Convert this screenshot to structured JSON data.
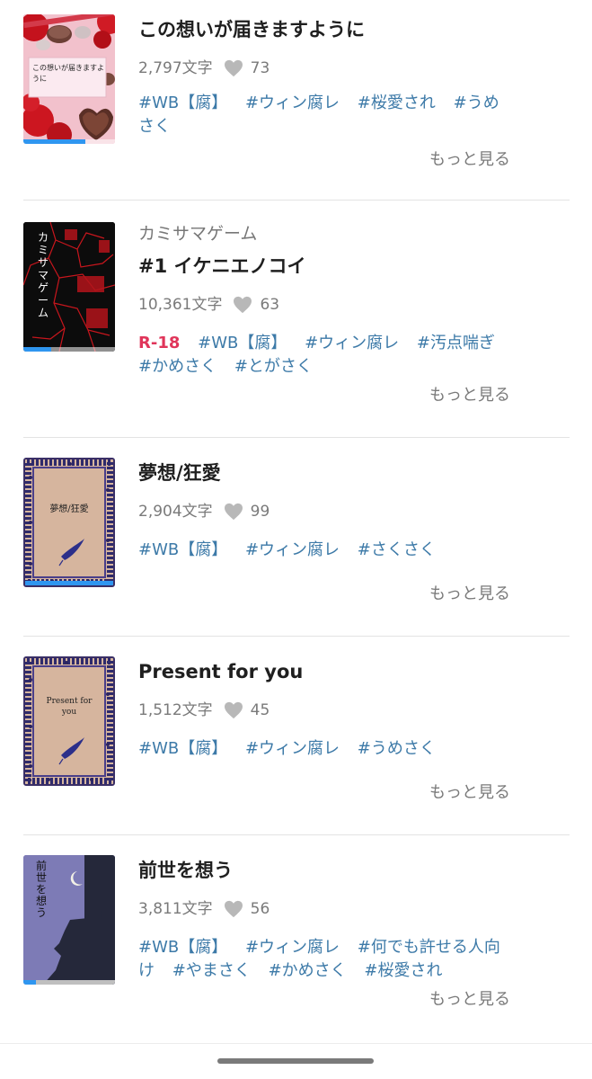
{
  "works": [
    {
      "series": "",
      "title": "この想いが届きますように",
      "chars": "2,797文字",
      "likes": "73",
      "r18": "",
      "tags": [
        "#WB【腐】",
        "#ウィン腐レ",
        "#桜愛され",
        "#うめさく"
      ],
      "more": "もっと見る",
      "cover_text": "この想いが届きますように",
      "progress": 0.68
    },
    {
      "series": "カミサマゲーム",
      "title": "#1 イケニエノコイ",
      "chars": "10,361文字",
      "likes": "63",
      "r18": "R-18",
      "tags": [
        "#WB【腐】",
        "#ウィン腐レ",
        "#汚点喘ぎ",
        "#かめさく",
        "#とがさく"
      ],
      "more": "もっと見る",
      "cover_text": "カミサマゲーム",
      "progress": 0.3
    },
    {
      "series": "",
      "title": "夢想/狂愛",
      "chars": "2,904文字",
      "likes": "99",
      "r18": "",
      "tags": [
        "#WB【腐】",
        "#ウィン腐レ",
        "#さくさく"
      ],
      "more": "もっと見る",
      "cover_text": "夢想/狂愛",
      "progress": 1.0
    },
    {
      "series": "",
      "title": "Present for you",
      "chars": "1,512文字",
      "likes": "45",
      "r18": "",
      "tags": [
        "#WB【腐】",
        "#ウィン腐レ",
        "#うめさく"
      ],
      "more": "もっと見る",
      "cover_text": "Present for you",
      "progress": 0
    },
    {
      "series": "",
      "title": "前世を想う",
      "chars": "3,811文字",
      "likes": "56",
      "r18": "",
      "tags": [
        "#WB【腐】",
        "#ウィン腐レ",
        "#何でも許せる人向け",
        "#やまさく",
        "#かめさく",
        "#桜愛され"
      ],
      "more": "もっと見る",
      "cover_text": "前世を想う",
      "progress": 0.14
    }
  ],
  "colors": {
    "tag": "#3d7aa8",
    "r18": "#e0355a",
    "progress": "#2f96f0",
    "muted": "#7a7a7a"
  },
  "icons": {
    "like": "heart-icon"
  }
}
